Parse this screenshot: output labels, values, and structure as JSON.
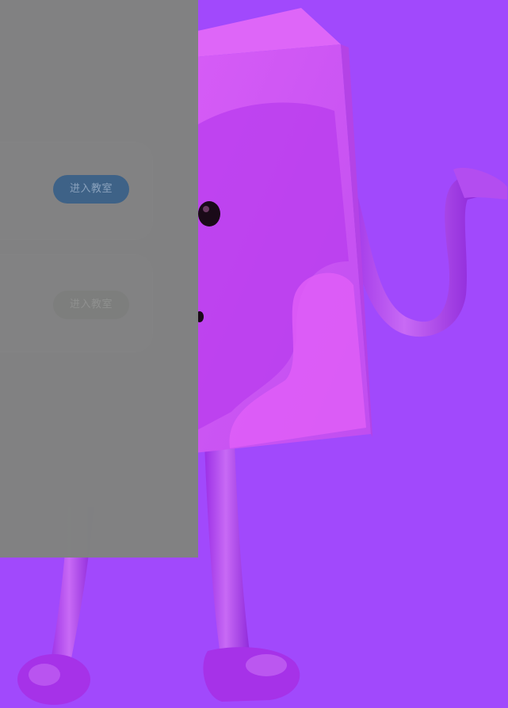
{
  "colors": {
    "background": "#a149fc",
    "panel": "#808280",
    "primary_button": "#3e6287",
    "disabled_button": "#7d7e7d"
  },
  "classroom_list": {
    "cards": [
      {
        "enter_label": "进入教室",
        "state": "enabled"
      },
      {
        "enter_label": "进入教室",
        "state": "disabled"
      }
    ]
  }
}
